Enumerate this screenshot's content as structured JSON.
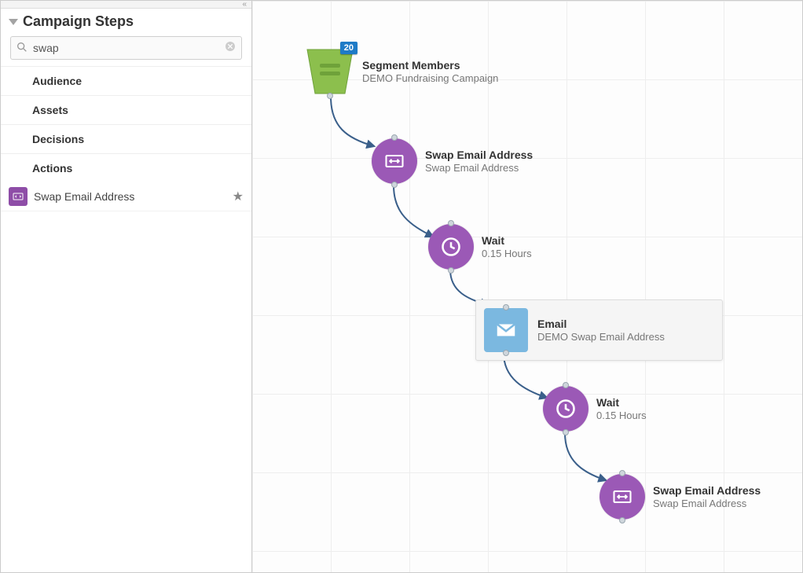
{
  "sidebar": {
    "title": "Campaign Steps",
    "search_value": "swap",
    "search_placeholder": "",
    "categories": [
      "Audience",
      "Assets",
      "Decisions",
      "Actions"
    ],
    "steps": [
      {
        "icon": "swap-email-icon",
        "label": "Swap Email Address"
      }
    ]
  },
  "canvas": {
    "nodes": [
      {
        "id": "seg",
        "type": "segment",
        "badge": "20",
        "title": "Segment Members",
        "sub": "DEMO Fundraising Campaign"
      },
      {
        "id": "swap1",
        "type": "action",
        "title": "Swap Email Address",
        "sub": "Swap Email Address"
      },
      {
        "id": "wait1",
        "type": "wait",
        "title": "Wait",
        "sub": "0.15 Hours"
      },
      {
        "id": "email",
        "type": "email",
        "title": "Email",
        "sub": "DEMO Swap Email Address"
      },
      {
        "id": "wait2",
        "type": "wait",
        "title": "Wait",
        "sub": "0.15 Hours"
      },
      {
        "id": "swap2",
        "type": "action",
        "title": "Swap Email Address",
        "sub": "Swap Email Address"
      }
    ]
  },
  "colors": {
    "segment": "#8cbf4d",
    "action": "#9b59b6",
    "email": "#7bb8e0",
    "badge": "#1e7bc7"
  }
}
